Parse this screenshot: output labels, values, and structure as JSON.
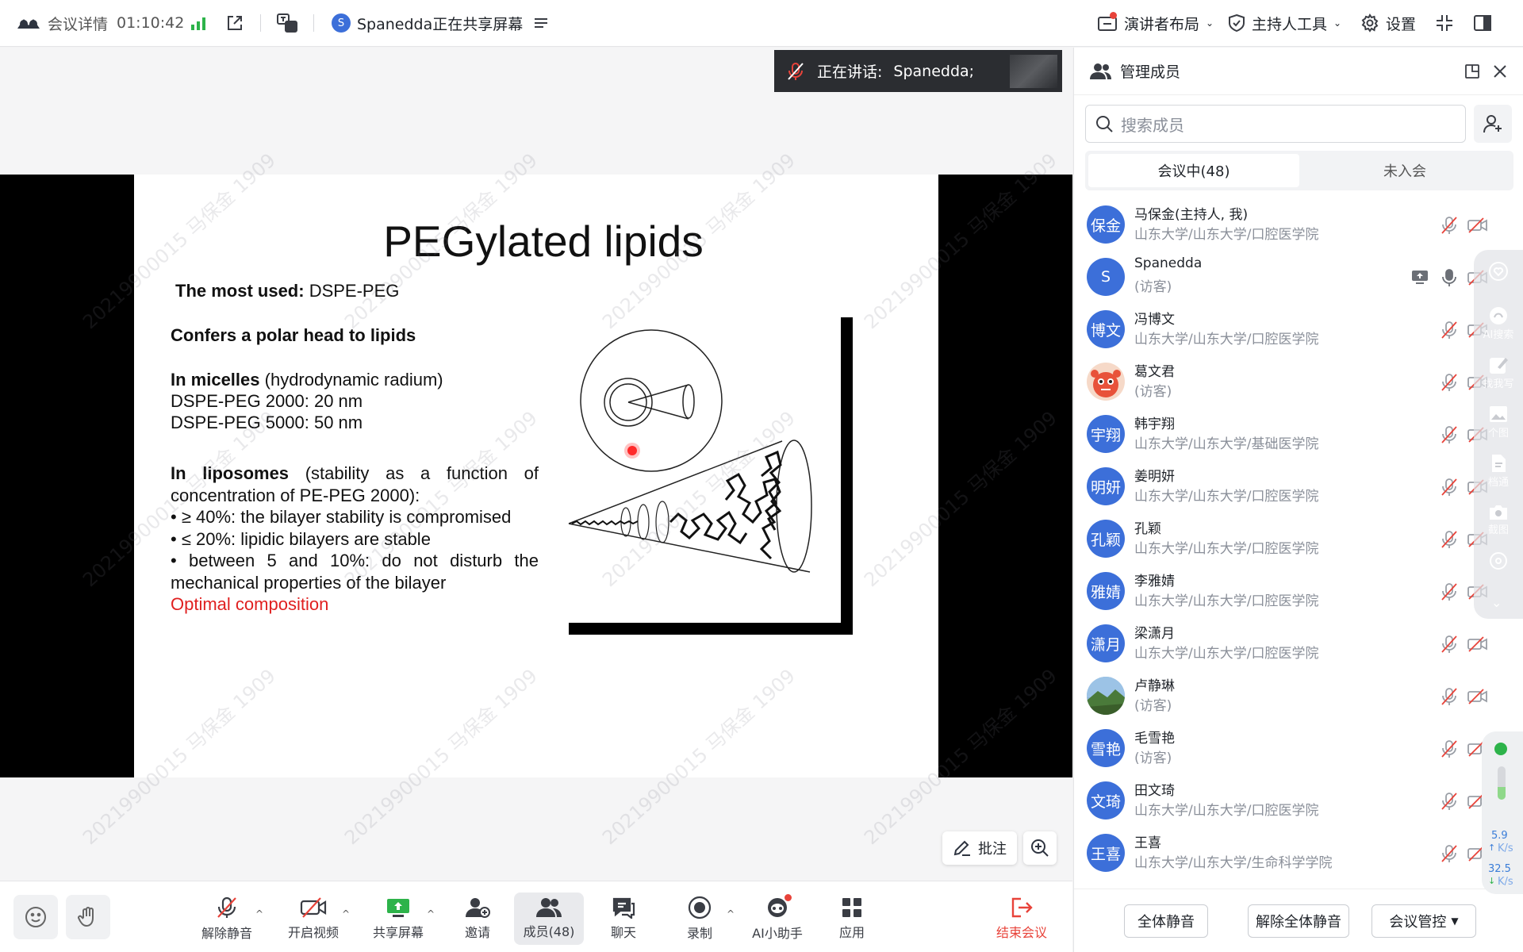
{
  "topbar": {
    "meeting_details": "会议详情",
    "elapsed": "01:10:42",
    "sharer_initial": "S",
    "sharing_text": "Spanedda正在共享屏幕",
    "speaker_layout": "演讲者布局",
    "host_tools": "主持人工具",
    "settings": "设置"
  },
  "stage": {
    "speaking_label": "正在讲话:",
    "speaking_name": "Spanedda;",
    "annotate": "批注",
    "watermark": "20219900015 马保金 1909"
  },
  "slide": {
    "title": "PEGylated lipids",
    "most_used_bold": "The most used:",
    "most_used_rest": " DSPE-PEG",
    "polar_head": "Confers a polar head to lipids",
    "micelles_bold": "In micelles",
    "micelles_rest": " (hydrodynamic radium)",
    "micelles_2000": "DSPE-PEG 2000: 20 nm",
    "micelles_5000": "DSPE-PEG 5000: 50 nm",
    "liposomes_bold": "In liposomes",
    "liposomes_rest": " (stability as a function of concentration of PE-PEG 2000):",
    "bullet1": "• ≥ 40%: the bilayer stability is compromised",
    "bullet2": "• ≤ 20%: lipidic bilayers are stable",
    "bullet3": "• between 5 and 10%: do not disturb the mechanical properties of the bilayer",
    "optimal": "Optimal composition"
  },
  "bottombar": {
    "unmute": "解除静音",
    "start_video": "开启视频",
    "share_screen": "共享屏幕",
    "invite": "邀请",
    "members": "成员(48)",
    "chat": "聊天",
    "record": "录制",
    "ai_assistant": "AI小助手",
    "apps": "应用",
    "end_meeting": "结束会议"
  },
  "panel": {
    "title": "管理成员",
    "search_placeholder": "搜索成员",
    "tab_in_meeting": "会议中(48)",
    "tab_not_joined": "未入会",
    "members": [
      {
        "avatar": "保金",
        "name": "马保金(主持人, 我)",
        "org": "山东大学/山东大学/口腔医学院",
        "kind": "text"
      },
      {
        "avatar": "S",
        "name": "Spanedda",
        "org": "(访客)",
        "kind": "text"
      },
      {
        "avatar": "博文",
        "name": "冯博文",
        "org": "山东大学/山东大学/口腔医学院",
        "kind": "text"
      },
      {
        "avatar": "",
        "name": "葛文君",
        "org": "(访客)",
        "kind": "photo-red"
      },
      {
        "avatar": "宇翔",
        "name": "韩宇翔",
        "org": "山东大学/山东大学/基础医学院",
        "kind": "text"
      },
      {
        "avatar": "明妍",
        "name": "姜明妍",
        "org": "山东大学/山东大学/口腔医学院",
        "kind": "text"
      },
      {
        "avatar": "孔颖",
        "name": "孔颖",
        "org": "山东大学/山东大学/口腔医学院",
        "kind": "text"
      },
      {
        "avatar": "雅婧",
        "name": "李雅婧",
        "org": "山东大学/山东大学/口腔医学院",
        "kind": "text"
      },
      {
        "avatar": "潇月",
        "name": "梁潇月",
        "org": "山东大学/山东大学/口腔医学院",
        "kind": "text"
      },
      {
        "avatar": "",
        "name": "卢静琳",
        "org": "(访客)",
        "kind": "photo-landscape"
      },
      {
        "avatar": "雪艳",
        "name": "毛雪艳",
        "org": "(访客)",
        "kind": "text"
      },
      {
        "avatar": "文琦",
        "name": "田文琦",
        "org": "山东大学/山东大学/口腔医学院",
        "kind": "text"
      },
      {
        "avatar": "王喜",
        "name": "王喜",
        "org": "山东大学/山东大学/生命科学学院",
        "kind": "text"
      }
    ],
    "mute_all": "全体静音",
    "unmute_all": "解除全体静音",
    "meeting_control": "会议管控"
  },
  "floating_tools": {
    "ai_search": "AI搜索",
    "find_write": "找我写",
    "image": "个图",
    "doc": "档通",
    "screenshot": "截图"
  },
  "network": {
    "up_value": "5.9",
    "up_unit": "K/s",
    "down_value": "32.5",
    "down_unit": "K/s"
  },
  "colors": {
    "accent": "#3c6fd9",
    "end_red": "#e8433a",
    "optimal_red": "#e02020",
    "signal_green": "#2db34a"
  }
}
